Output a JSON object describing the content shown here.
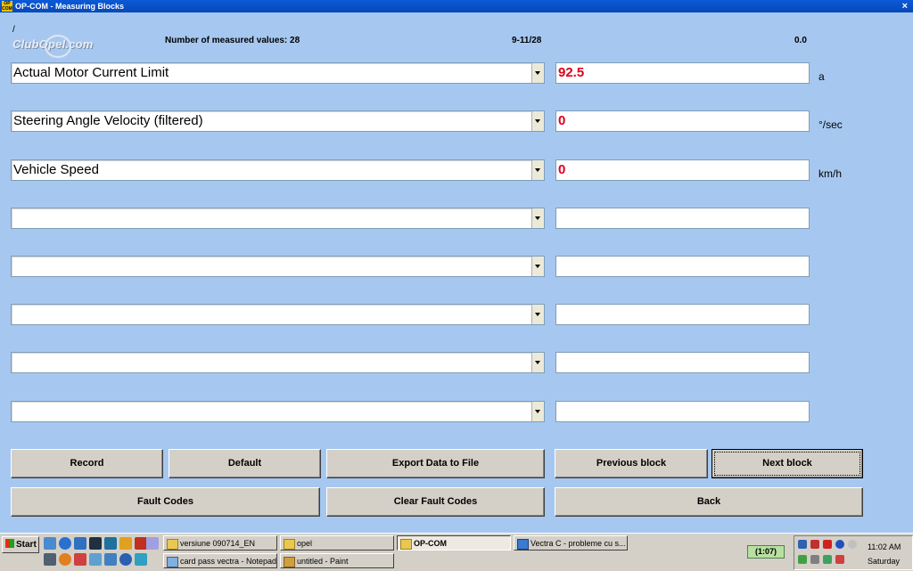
{
  "window": {
    "title": "OP-COM - Measuring Blocks",
    "app_icon_text": "OP COM",
    "close_label": "×"
  },
  "header": {
    "slash": "/",
    "logo_text": "ClubOpel.com",
    "measured_values": "Number of measured values: 28",
    "block_range": "9-11/28",
    "timer_value": "0.0"
  },
  "rows": [
    {
      "label": "Actual Motor Current Limit",
      "value": "92.5",
      "unit": "a"
    },
    {
      "label": "Steering Angle Velocity (filtered)",
      "value": "0",
      "unit": "°/sec"
    },
    {
      "label": "Vehicle Speed",
      "value": "0",
      "unit": "km/h"
    },
    {
      "label": "",
      "value": "",
      "unit": ""
    },
    {
      "label": "",
      "value": "",
      "unit": ""
    },
    {
      "label": "",
      "value": "",
      "unit": ""
    },
    {
      "label": "",
      "value": "",
      "unit": ""
    },
    {
      "label": "",
      "value": "",
      "unit": ""
    }
  ],
  "buttons": {
    "record": "Record",
    "default": "Default",
    "export": "Export Data to File",
    "previous": "Previous block",
    "next": "Next block",
    "fault_codes": "Fault Codes",
    "clear_fault_codes": "Clear Fault Codes",
    "back": "Back"
  },
  "taskbar": {
    "start": "Start",
    "tasks": [
      "versiune 090714_EN",
      "opel",
      "OP-COM",
      "Vectra C - probleme cu s...",
      "card pass vectra - Notepad",
      "untitled - Paint"
    ],
    "timer": "(1:07)",
    "clock": "11:02 AM",
    "day": "Saturday"
  },
  "colors": {
    "background": "#a6c8f0",
    "value_text": "#e0001c",
    "titlebar": "#0a5ad8"
  }
}
